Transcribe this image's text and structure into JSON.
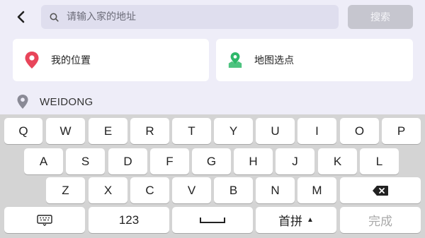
{
  "header": {
    "search_placeholder": "请输入家的地址",
    "search_button_label": "搜索"
  },
  "options": {
    "my_location_label": "我的位置",
    "map_pick_label": "地图选点"
  },
  "current_location": {
    "text": "WEIDONG"
  },
  "colors": {
    "page_bg": "#eeedf8",
    "location_pin": "#e8455a",
    "map_pin": "#2fb86a",
    "location_marker": "#8a8a96"
  },
  "keyboard": {
    "row1": [
      "Q",
      "W",
      "E",
      "R",
      "T",
      "Y",
      "U",
      "I",
      "O",
      "P"
    ],
    "row2": [
      "A",
      "S",
      "D",
      "F",
      "G",
      "H",
      "J",
      "K",
      "L"
    ],
    "row3": [
      "Z",
      "X",
      "C",
      "V",
      "B",
      "N",
      "M"
    ],
    "numbers_label": "123",
    "ime_label": "首拼",
    "ime_arrow": "▲",
    "done_label": "完成"
  }
}
